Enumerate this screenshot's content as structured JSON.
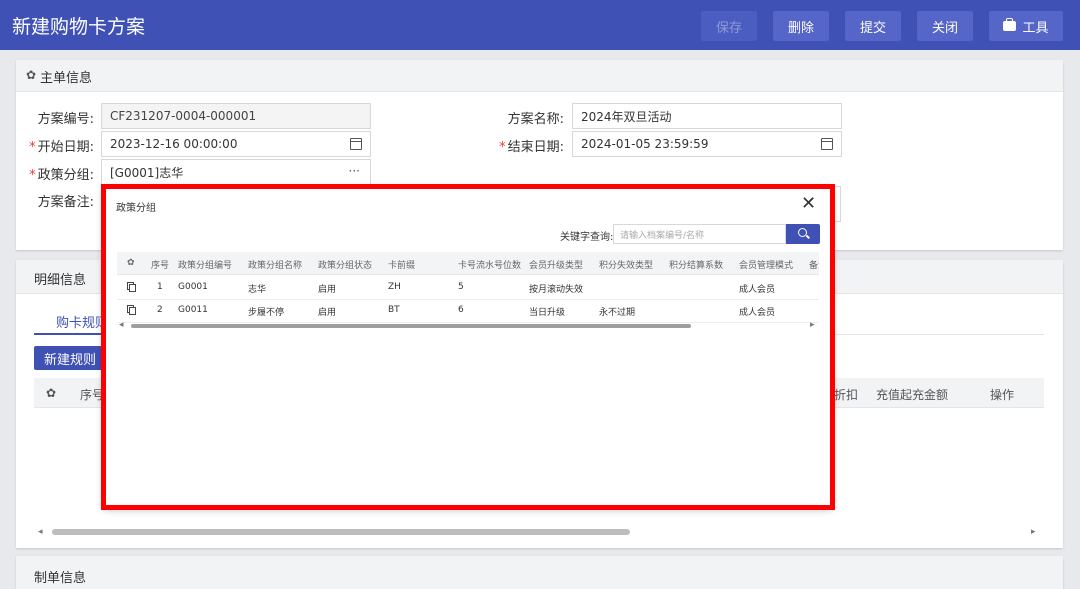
{
  "header": {
    "title": "新建购物卡方案",
    "buttons": {
      "save": "保存",
      "delete": "删除",
      "submit": "提交",
      "close": "关闭",
      "tools": "工具"
    }
  },
  "main_info": {
    "section_title": "主单信息",
    "scheme_no_label": "方案编号:",
    "scheme_no_value": "CF231207-0004-000001",
    "scheme_name_label": "方案名称:",
    "scheme_name_value": "2024年双旦活动",
    "start_date_label": "开始日期:",
    "start_date_value": "2023-12-16 00:00:00",
    "end_date_label": "结束日期:",
    "end_date_value": "2024-01-05 23:59:59",
    "policy_group_label": "政策分组:",
    "policy_group_value": "[G0001]志华",
    "remark_label": "方案备注:",
    "required_mark": "*",
    "more_dots": "···"
  },
  "detail": {
    "section_title": "明细信息",
    "tab_label": "购卡规则",
    "new_rule_button": "新建规则",
    "grid_headers": {
      "seq": "序号",
      "discount": "折扣",
      "recharge_min": "充值起充金额",
      "action": "操作"
    }
  },
  "creator": {
    "section_title": "制单信息"
  },
  "modal": {
    "title": "政策分组",
    "close_glyph": "✕",
    "keyword_label": "关键字查询:",
    "keyword_placeholder": "请输入档案编号/名称",
    "columns": [
      "序号",
      "政策分组编号",
      "政策分组名称",
      "政策分组状态",
      "卡前缀",
      "卡号流水号位数",
      "会员升级类型",
      "积分失效类型",
      "积分结算系数",
      "会员管理模式",
      "备注"
    ],
    "rows": [
      {
        "seq": "1",
        "code": "G0001",
        "name": "志华",
        "status": "启用",
        "prefix": "ZH",
        "digits": "5",
        "upgrade": "按月滚动失效",
        "expire": "",
        "coef": "",
        "mode": "成人会员"
      },
      {
        "seq": "2",
        "code": "G0011",
        "name": "步履不停",
        "status": "启用",
        "prefix": "BT",
        "digits": "6",
        "upgrade": "当日升级",
        "expire": "永不过期",
        "coef": "",
        "mode": "成人会员"
      }
    ],
    "scroll_right": "▸",
    "scroll_left": "◂"
  },
  "colors": {
    "primary": "#3f51b5",
    "highlight": "#ff0000",
    "required": "#e53935"
  }
}
